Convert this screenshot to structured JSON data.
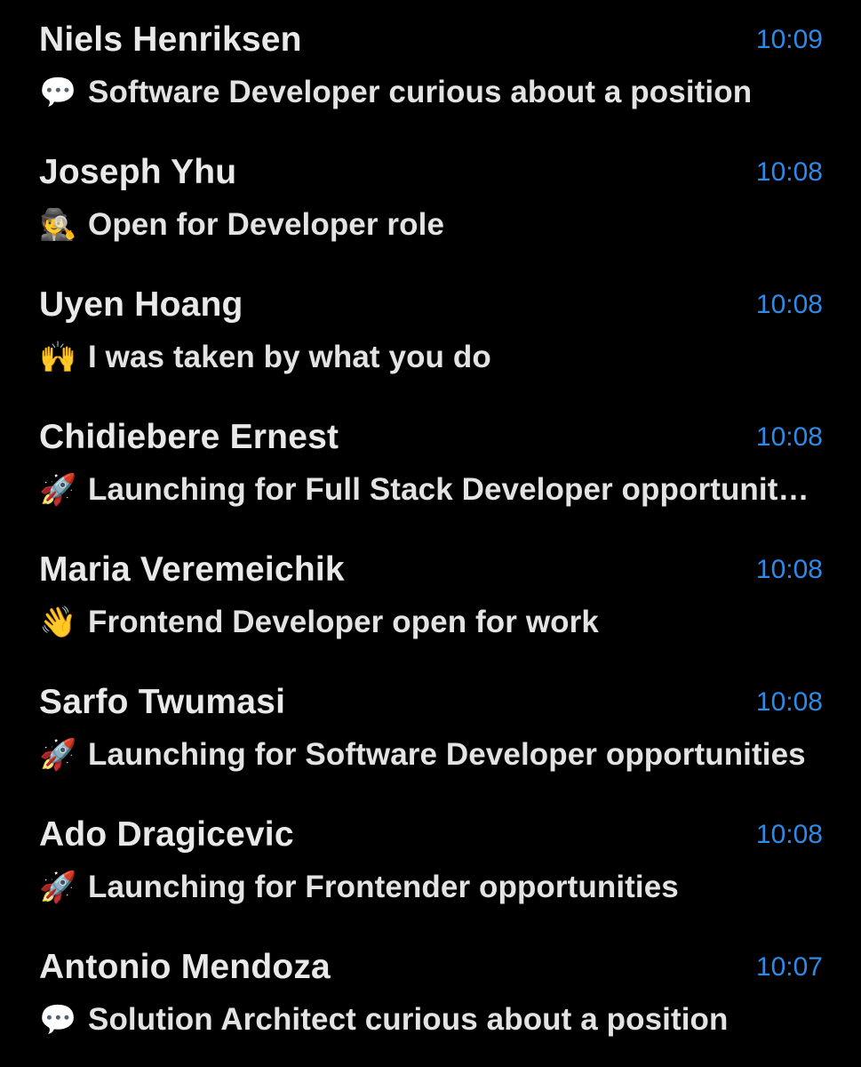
{
  "conversations": [
    {
      "name": "Niels Henriksen",
      "time": "10:09",
      "icon": "speech-bubble-icon",
      "emoji": "💬",
      "preview": "Software Developer curious about a position"
    },
    {
      "name": "Joseph Yhu",
      "time": "10:08",
      "icon": "detective-icon",
      "emoji": "🕵",
      "preview": "Open for Developer role"
    },
    {
      "name": "Uyen Hoang",
      "time": "10:08",
      "icon": "raising-hands-icon",
      "emoji": "🙌",
      "preview": "I was taken by what you do"
    },
    {
      "name": "Chidiebere Ernest",
      "time": "10:08",
      "icon": "rocket-icon",
      "emoji": "🚀",
      "preview": "Launching for Full Stack Developer opportuniti…"
    },
    {
      "name": "Maria Veremeichik",
      "time": "10:08",
      "icon": "waving-hand-icon",
      "emoji": "👋",
      "preview": "Frontend Developer open for work"
    },
    {
      "name": "Sarfo Twumasi",
      "time": "10:08",
      "icon": "rocket-icon",
      "emoji": "🚀",
      "preview": "Launching for Software Developer opportunities"
    },
    {
      "name": "Ado Dragicevic",
      "time": "10:08",
      "icon": "rocket-icon",
      "emoji": "🚀",
      "preview": "Launching for Frontender opportunities"
    },
    {
      "name": "Antonio Mendoza",
      "time": "10:07",
      "icon": "speech-bubble-icon",
      "emoji": "💬",
      "preview": "Solution Architect curious about a position"
    }
  ],
  "colors": {
    "background": "#000000",
    "name_text": "#e9e9e9",
    "preview_text": "#e3e3e3",
    "time_accent": "#2d8ae6"
  }
}
